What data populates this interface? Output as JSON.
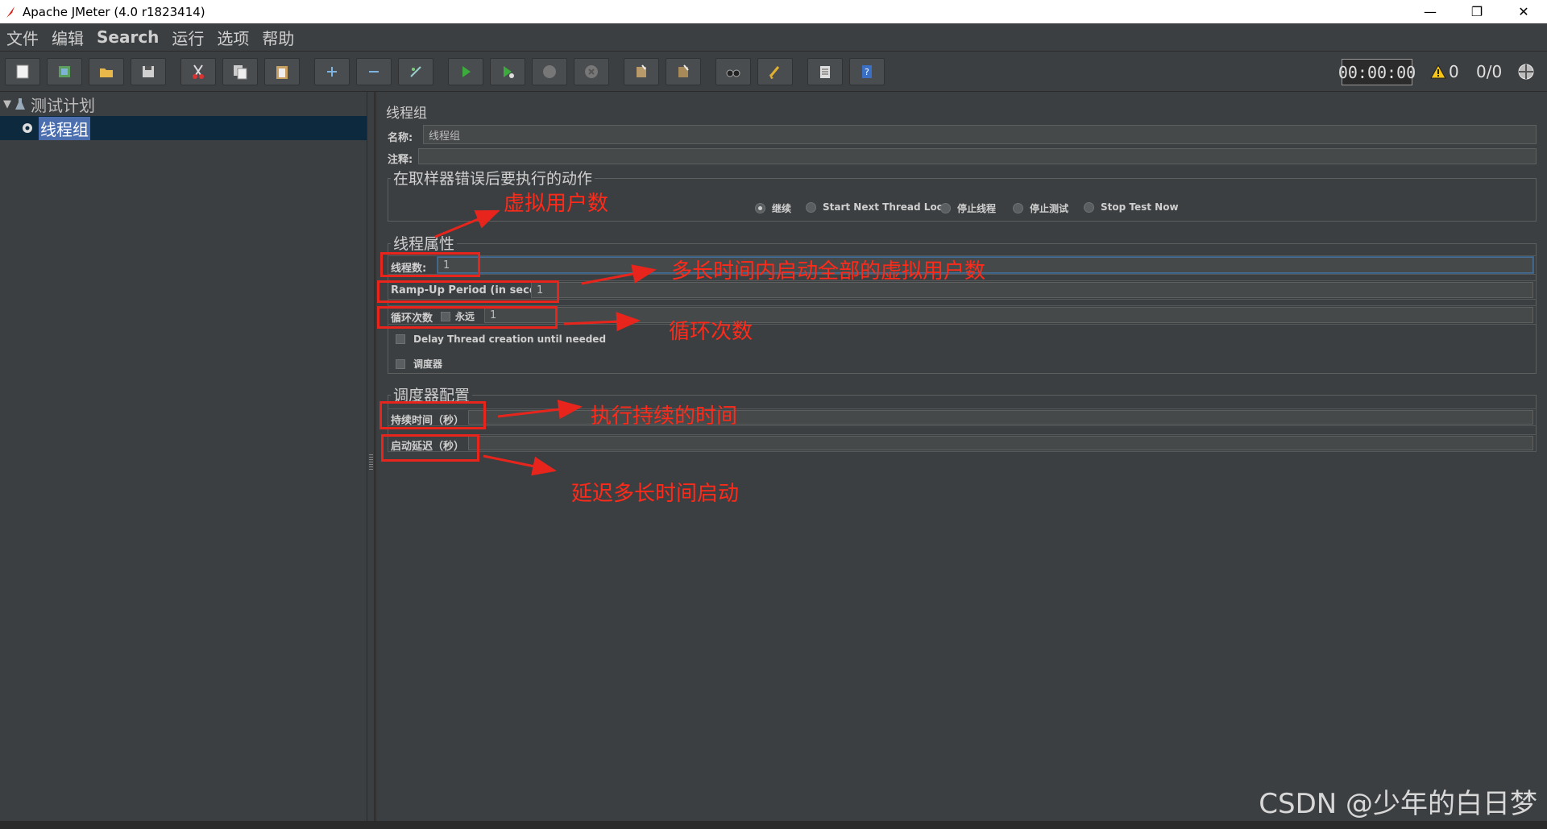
{
  "window": {
    "title": "Apache JMeter (4.0 r1823414)",
    "min": "—",
    "max": "❐",
    "close": "✕"
  },
  "menu": [
    "文件",
    "编辑",
    "Search",
    "运行",
    "选项",
    "帮助"
  ],
  "toolbar": {
    "timer": "00:00:00",
    "warnings": "0",
    "ratio": "0/0"
  },
  "tree": {
    "root": "测试计划",
    "child": "线程组"
  },
  "panel": {
    "title": "线程组",
    "name_label": "名称:",
    "name_value": "线程组",
    "comment_label": "注释:",
    "error_group_title": "在取样器错误后要执行的动作",
    "error_options": [
      "继续",
      "Start Next Thread Loop",
      "停止线程",
      "停止测试",
      "Stop Test Now"
    ],
    "thread_props_title": "线程属性",
    "threads_label": "线程数:",
    "threads_value": "1",
    "rampup_label": "Ramp-Up Period (in seconds):",
    "rampup_value": "1",
    "loop_label": "循环次数",
    "forever_label": "永远",
    "loop_value": "1",
    "delay_label": "Delay Thread creation until needed",
    "scheduler_label": "调度器",
    "scheduler_config_title": "调度器配置",
    "duration_label": "持续时间（秒）",
    "startup_delay_label": "启动延迟（秒）"
  },
  "annotations": {
    "virtual_users": "虚拟用户数",
    "rampup_desc": "多长时间内启动全部的虚拟用户数",
    "loop_desc": "循环次数",
    "duration_desc": "执行持续的时间",
    "delay_desc": "延迟多长时间启动"
  },
  "watermark": "CSDN @少年的白日梦"
}
